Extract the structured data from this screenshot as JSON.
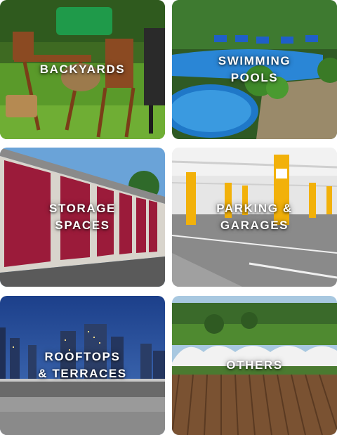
{
  "tiles": [
    {
      "line1": "BACKYARDS",
      "line2": ""
    },
    {
      "line1": "SWIMMING",
      "line2": "POOLS"
    },
    {
      "line1": "STORAGE",
      "line2": "SPACES"
    },
    {
      "line1": "PARKING &",
      "line2": "GARAGES"
    },
    {
      "line1": "ROOFTOPS",
      "line2": "& TERRACES"
    },
    {
      "line1": "OTHERS",
      "line2": ""
    }
  ],
  "colors": {
    "label_text": "#ffffff",
    "grass": "#5a9a2a",
    "pool_water": "#1f78c8",
    "storage_door": "#9b1b3a",
    "parking_pillar": "#f2b10a",
    "night_sky": "#1c3f8a",
    "field_soil": "#7a5232"
  }
}
